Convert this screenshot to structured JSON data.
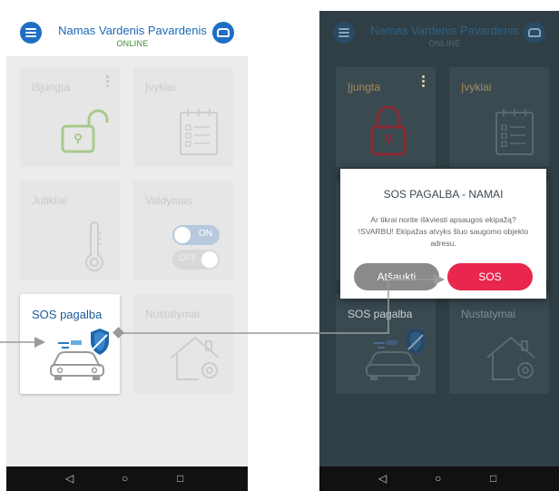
{
  "header": {
    "user_name": "Namas Vardenis Pavardenis",
    "status": "ONLINE",
    "menu_icon": "hamburger-icon",
    "car_icon": "car-icon"
  },
  "left_screen": {
    "tiles": [
      {
        "label": "Išjungta",
        "icon": "unlocked-padlock-icon"
      },
      {
        "label": "Įvykiai",
        "icon": "event-list-icon"
      },
      {
        "label": "Jutikliai",
        "icon": "thermometer-icon"
      },
      {
        "label": "Valdymas",
        "icon": "toggle-switches-icon",
        "toggle_on": "ON",
        "toggle_off": "OFF"
      },
      {
        "label": "SOS pagalba",
        "icon": "patrol-car-shield-icon"
      },
      {
        "label": "Nustatymai",
        "icon": "house-gear-icon"
      }
    ]
  },
  "right_screen": {
    "tiles": [
      {
        "label": "Įjungta",
        "icon": "locked-padlock-icon"
      },
      {
        "label": "Įvykiai",
        "icon": "event-list-icon"
      },
      {
        "label": "SOS pagalba",
        "icon": "patrol-car-shield-icon"
      },
      {
        "label": "Nustatymai",
        "icon": "house-gear-icon"
      }
    ],
    "dialog": {
      "title": "SOS PAGALBA - NAMAI",
      "message": "Ar tikrai norite iškviesti apsaugos ekipažą? !SVARBU! Ekipažas atvyks šluo saugomo objekto adresu.",
      "cancel_label": "Atšaukti",
      "sos_label": "SOS"
    }
  },
  "navbar": {
    "back": "◁",
    "home": "○",
    "recent": "□"
  },
  "colors": {
    "brand_blue": "#1e6fc4",
    "online_green": "#3e8a2f",
    "sos_red": "#e8264e",
    "cancel_gray": "#8a8a8a",
    "overlay_dark": "#2f3f45"
  }
}
